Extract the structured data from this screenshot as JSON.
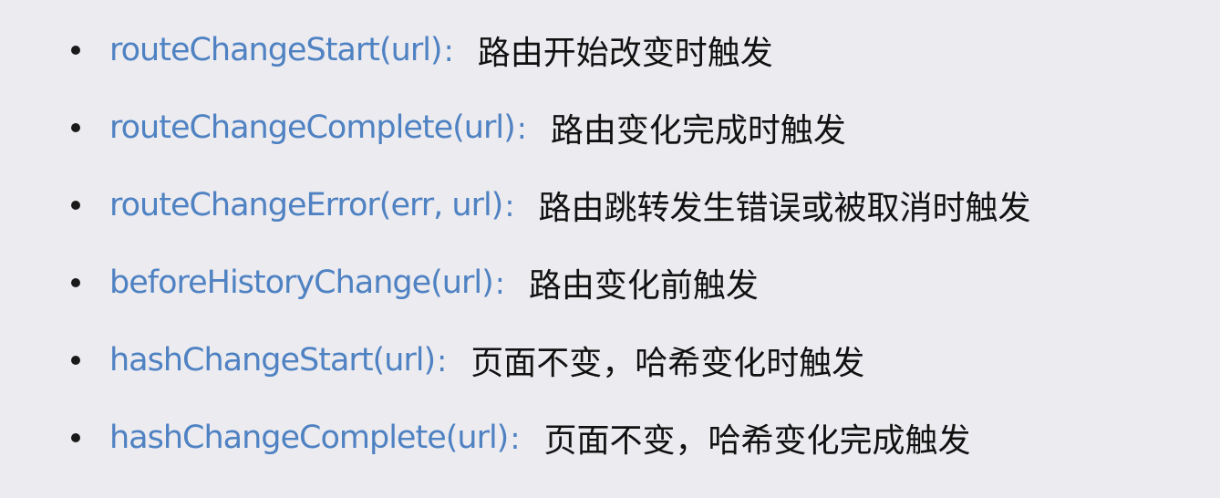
{
  "items": [
    {
      "event": "routeChangeStart(url)",
      "sep": ":",
      "desc": "路由开始改变时触发"
    },
    {
      "event": "routeChangeComplete(url)",
      "sep": ":",
      "desc": "路由变化完成时触发"
    },
    {
      "event": "routeChangeError(err, url)",
      "sep": ":",
      "desc": "路由跳转发生错误或被取消时触发"
    },
    {
      "event": "beforeHistoryChange(url)",
      "sep": ":",
      "desc": "路由变化前触发"
    },
    {
      "event": "hashChangeStart(url)",
      "sep": ":",
      "desc": "页面不变，哈希变化时触发"
    },
    {
      "event": "hashChangeComplete(url)",
      "sep": ":",
      "desc": "页面不变，哈希变化完成触发"
    }
  ]
}
